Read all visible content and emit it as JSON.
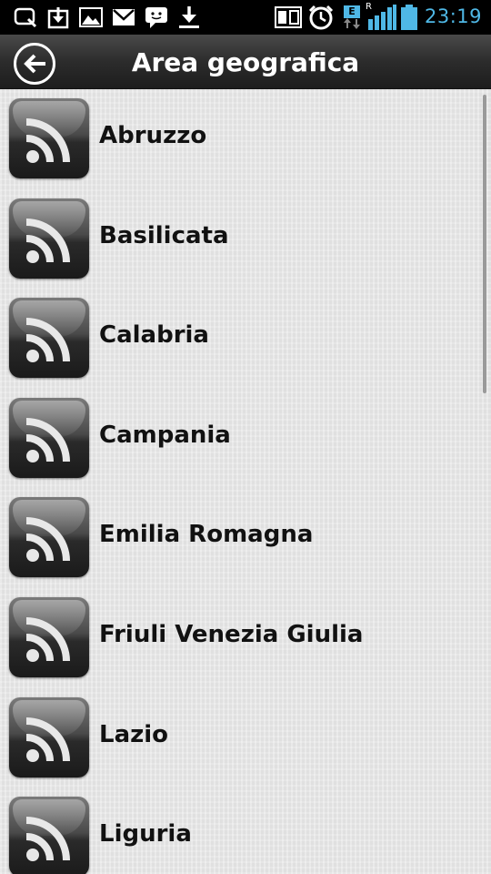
{
  "status_bar": {
    "clock": "23:19",
    "signal_letter": "R",
    "network_letter": "E",
    "icons": [
      "search-app-icon",
      "download-box-icon",
      "image-icon",
      "gmail-icon",
      "chat-icon",
      "download-icon",
      "nfc-icon",
      "alarm-icon",
      "network-e-icon",
      "signal-icon",
      "battery-icon"
    ],
    "accent_color": "#4fb8e6"
  },
  "action_bar": {
    "title": "Area geografica"
  },
  "regions": [
    "Abruzzo",
    "Basilicata",
    "Calabria",
    "Campania",
    "Emilia Romagna",
    "Friuli Venezia Giulia",
    "Lazio",
    "Liguria"
  ]
}
